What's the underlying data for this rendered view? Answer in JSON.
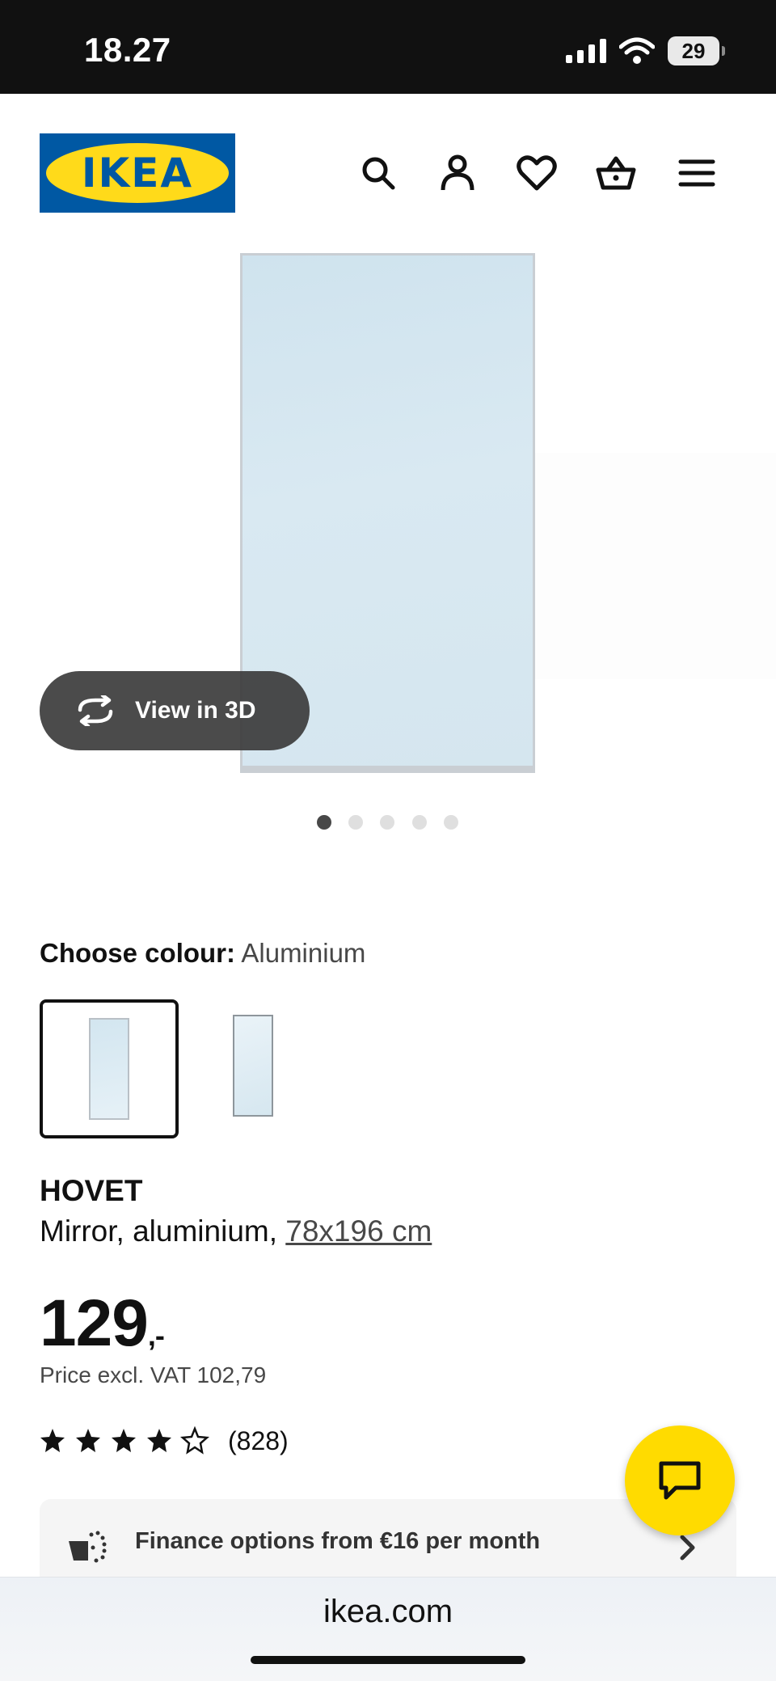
{
  "status_bar": {
    "time": "18.27",
    "battery": "29"
  },
  "header": {
    "logo_text": "IKEA"
  },
  "gallery": {
    "view_3d_label": "View in 3D",
    "dots_count": 5,
    "active_dot": 0
  },
  "colour": {
    "label": "Choose colour:",
    "value": "Aluminium"
  },
  "product": {
    "name": "HOVET",
    "description": "Mirror, aluminium, ",
    "size_link": "78x196 cm",
    "price_main": "129",
    "price_suffix": ",-",
    "price_excl_vat": "Price excl. VAT 102,79",
    "rating": 4.5,
    "rating_count": "(828)"
  },
  "finance": {
    "text": "Finance options from €16 per month"
  },
  "browser": {
    "url": "ikea.com"
  },
  "colors": {
    "ikea_blue": "#0058a3",
    "ikea_yellow": "#ffda1a",
    "chat_yellow": "#ffdb00"
  }
}
